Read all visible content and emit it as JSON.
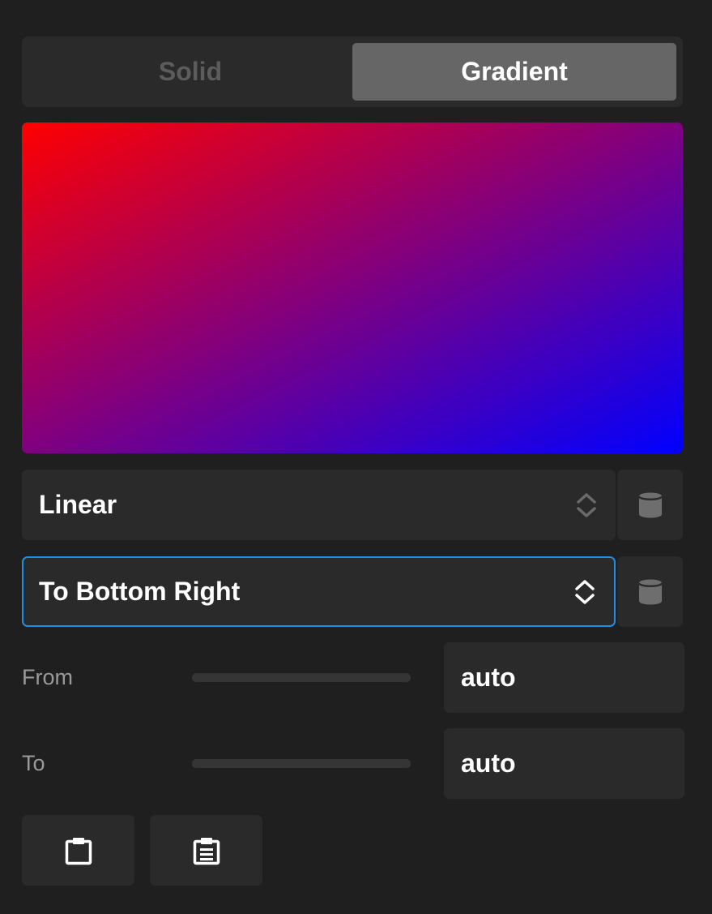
{
  "mode_tabs": {
    "solid_label": "Solid",
    "gradient_label": "Gradient",
    "active": "Gradient"
  },
  "preview": {
    "gradient_start": "#ff0000",
    "gradient_end": "#0000ff",
    "direction": "to bottom right"
  },
  "gradient_type": {
    "value": "Linear",
    "chevron_icon": "chevron-up-down-icon",
    "side_icon": "database-icon"
  },
  "gradient_direction": {
    "value": "To Bottom Right",
    "chevron_icon": "chevron-up-down-icon",
    "side_icon": "database-icon"
  },
  "from": {
    "label": "From",
    "value": "auto"
  },
  "to": {
    "label": "To",
    "value": "auto"
  },
  "toolbar": {
    "copy_icon": "clipboard-icon",
    "paste_icon": "clipboard-list-icon"
  },
  "colors": {
    "background": "#1f1f1f",
    "surface": "#2a2a2a",
    "active_tab": "#666666",
    "focus_border": "#1e8fe1"
  }
}
